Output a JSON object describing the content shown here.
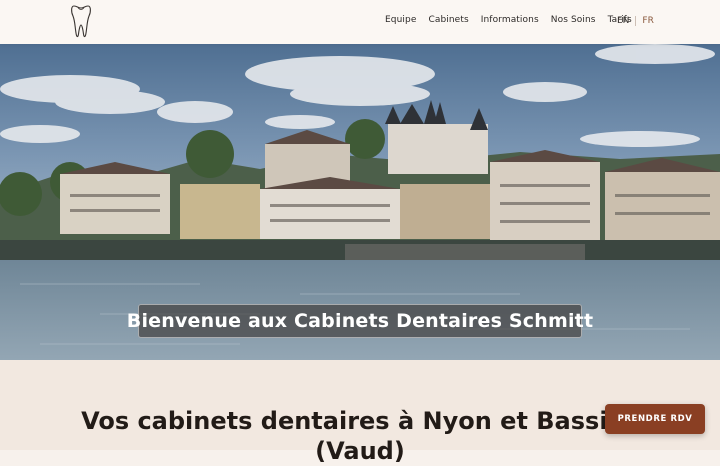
{
  "header": {
    "logo_icon": "tooth-icon",
    "nav": [
      {
        "label": "Equipe"
      },
      {
        "label": "Cabinets"
      },
      {
        "label": "Informations"
      },
      {
        "label": "Nos Soins"
      },
      {
        "label": "Tarifs"
      }
    ],
    "languages": {
      "en": "EN",
      "fr": "FR",
      "active": "FR"
    }
  },
  "hero": {
    "title": "Bienvenue aux Cabinets Dentaires Schmitt",
    "image_subject": "nyon-lakefront-castle-photo"
  },
  "intro": {
    "heading": "Vos cabinets dentaires à Nyon et Bassins (Vaud)"
  },
  "cta": {
    "label": "PRENDRE RDV"
  },
  "colors": {
    "accent": "#8a3f23",
    "header_bg": "#fbf7f3",
    "section_bg": "#f2e8e0"
  }
}
